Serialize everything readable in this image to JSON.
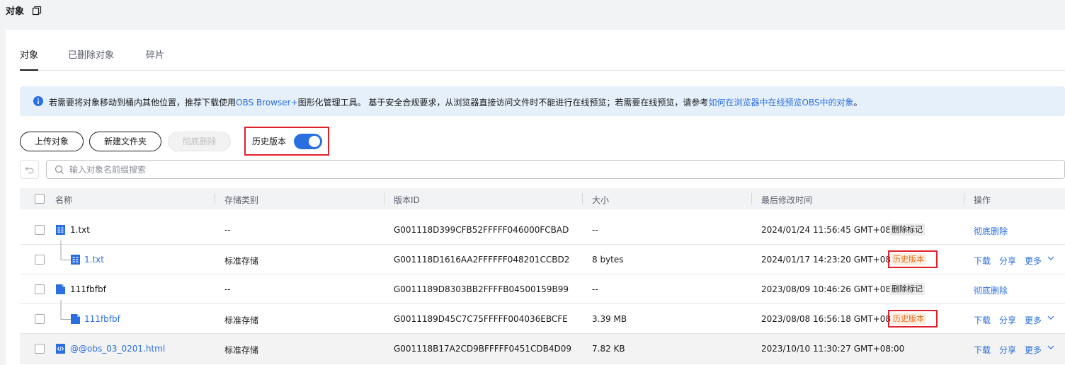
{
  "header": {
    "title": "对象"
  },
  "tabs": [
    {
      "label": "对象",
      "active": true
    },
    {
      "label": "已删除对象",
      "active": false
    },
    {
      "label": "碎片",
      "active": false
    }
  ],
  "notice": {
    "text1": "若需要将对象移动到桶内其他位置，推荐下载使用",
    "link1": "OBS Browser+",
    "text2": "图形化管理工具。 基于安全合规要求，从浏览器直接访问文件时不能进行在线预览；若需要在线预览，请参考",
    "link2": "如何在浏览器中在线预览OBS中的对象",
    "text3": "。"
  },
  "toolbar": {
    "upload": "上传对象",
    "new_folder": "新建文件夹",
    "delete_permanent": "彻底删除",
    "history_label": "历史版本",
    "history_on": true
  },
  "search": {
    "placeholder": "输入对象名前缀搜索",
    "value": ""
  },
  "table": {
    "columns": [
      "名称",
      "存储类别",
      "版本ID",
      "大小",
      "最后修改时间",
      "操作"
    ],
    "rows": [
      {
        "name": "1.txt",
        "type": "txt",
        "child": false,
        "storage": "--",
        "version_id": "G001118D399CFB52FFFFF046000FCBAD",
        "size": "--",
        "modified": "2024/01/24 11:56:45 GMT+08:00",
        "badge": "删除标记",
        "badge_kind": "delete",
        "actions": [
          "彻底删除"
        ]
      },
      {
        "name": "1.txt",
        "type": "txt",
        "child": true,
        "storage": "标准存储",
        "version_id": "G001118D1616AA2FFFFFF048201CCBD2",
        "size": "8 bytes",
        "modified": "2024/01/17 14:23:20 GMT+08:00",
        "badge": "历史版本",
        "badge_kind": "history",
        "actions": [
          "下载",
          "分享",
          "更多"
        ]
      },
      {
        "name": "111fbfbf",
        "type": "file",
        "child": false,
        "storage": "--",
        "version_id": "G0011189D8303BB2FFFFB04500159B99",
        "size": "--",
        "modified": "2023/08/09 10:46:26 GMT+08:00",
        "badge": "删除标记",
        "badge_kind": "delete",
        "actions": [
          "彻底删除"
        ]
      },
      {
        "name": "111fbfbf",
        "type": "file",
        "child": true,
        "storage": "标准存储",
        "version_id": "G0011189D45C7C75FFFFF004036EBCFE",
        "size": "3.39 MB",
        "modified": "2023/08/08 16:56:18 GMT+08:00",
        "badge": "历史版本",
        "badge_kind": "history",
        "actions": [
          "下载",
          "分享",
          "更多"
        ]
      },
      {
        "name": "@@obs_03_0201.html",
        "type": "html",
        "child": false,
        "storage": "标准存储",
        "version_id": "G001118B17A2CD9BFFFFF0451CDB4D09",
        "size": "7.82 KB",
        "modified": "2023/10/10 11:30:27 GMT+08:00",
        "badge": "",
        "badge_kind": "",
        "actions": [
          "下载",
          "分享",
          "更多"
        ]
      }
    ]
  },
  "colors": {
    "accent": "#2a6fe0",
    "highlight": "#e0202b",
    "history_badge": "#e66a12"
  }
}
